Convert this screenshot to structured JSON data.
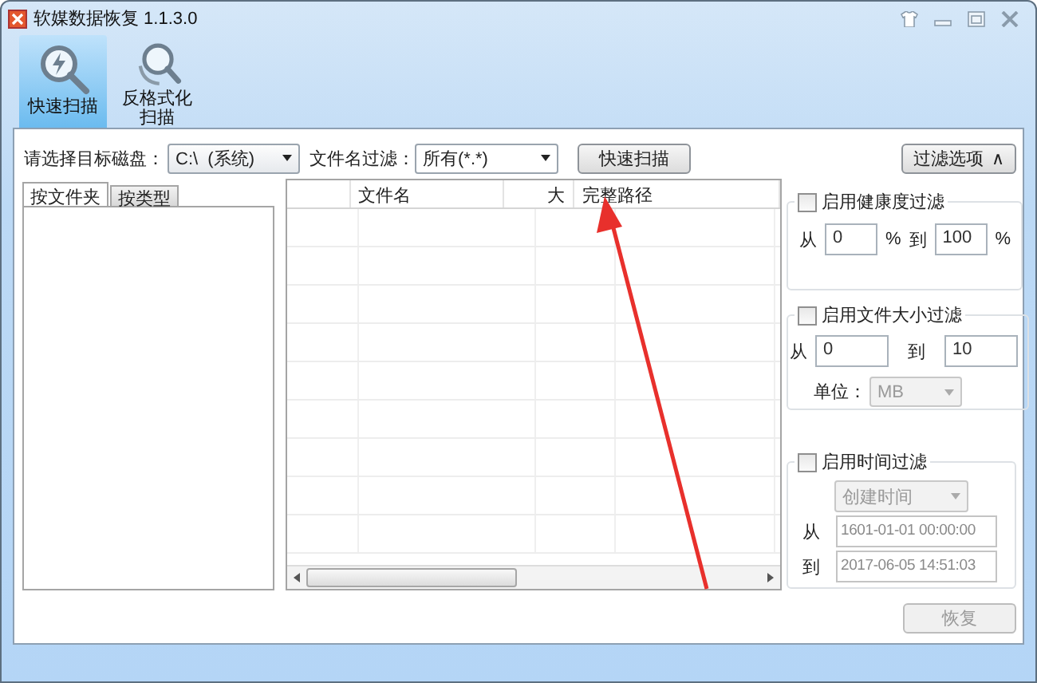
{
  "window": {
    "title": "软媒数据恢复 1.1.3.0"
  },
  "toolbar": [
    {
      "label": "快速扫描",
      "selected": true,
      "kind": "quick"
    },
    {
      "label": "反格式化扫描",
      "selected": false,
      "kind": "unformat"
    }
  ],
  "disk": {
    "label": "请选择目标磁盘：",
    "value": "C:\\  (系统)"
  },
  "name_filter": {
    "label": "文件名过滤：",
    "value": "所有(*.*)"
  },
  "scan_button": "快速扫描",
  "filter_toggle": {
    "label": "过滤选项",
    "arrow": "∧"
  },
  "tabs": [
    {
      "label": "按文件夹",
      "selected": true
    },
    {
      "label": "按类型",
      "selected": false
    }
  ],
  "table": {
    "columns": [
      "文件名",
      "大",
      "完整路径"
    ]
  },
  "filters": [
    {
      "kind": "health",
      "label": "启用健康度过滤",
      "checked": false,
      "from_label": "从",
      "from": "0",
      "unit1": "%",
      "to_label": "到",
      "to": "100",
      "unit2": "%"
    },
    {
      "kind": "size",
      "label": "启用文件大小过滤",
      "checked": false,
      "from_label": "从",
      "from": "0",
      "to_label": "到",
      "to": "10",
      "unit_label": "单位：",
      "unit": "MB",
      "unit_disabled": true
    },
    {
      "kind": "time",
      "label": "启用时间过滤",
      "checked": false,
      "field": "创建时间",
      "field_disabled": true,
      "from_label": "从",
      "from": "1601-01-01 00:00:00",
      "to_label": "到",
      "to": "2017-06-05 14:51:03",
      "inputs_disabled": true
    }
  ],
  "restore_button": {
    "label": "恢复",
    "disabled": true
  }
}
